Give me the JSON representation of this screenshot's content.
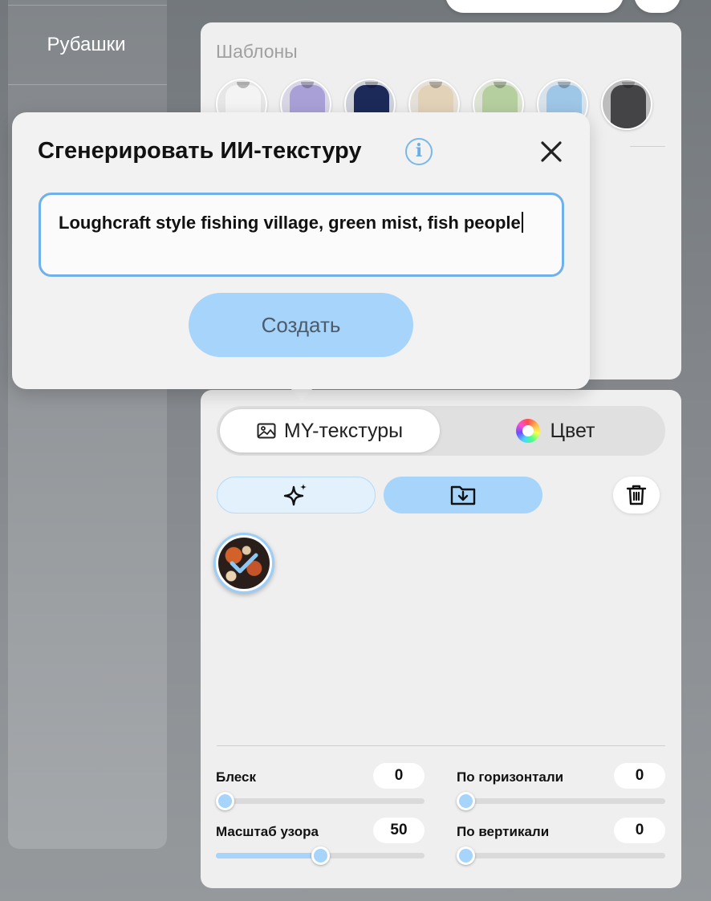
{
  "sidebar": {
    "active_item": "Рубашки"
  },
  "templates": {
    "title": "Шаблоны",
    "swatches": [
      {
        "name": "white",
        "color": "#f4f4f4"
      },
      {
        "name": "lavender",
        "color": "#a9a0d8"
      },
      {
        "name": "navy",
        "color": "#1c2a5a"
      },
      {
        "name": "beige",
        "color": "#e2d2b8"
      },
      {
        "name": "sage",
        "color": "#b6cf9f"
      },
      {
        "name": "sky",
        "color": "#9ec6e6"
      },
      {
        "name": "charcoal",
        "color": "#444446"
      }
    ]
  },
  "dialog": {
    "title": "Сгенерировать ИИ-текстуру",
    "info_icon": "info-icon",
    "close_icon": "close-icon",
    "prompt_value": "Loughcraft style fishing village, green mist, fish people",
    "create_label": "Создать"
  },
  "tabs": {
    "textures_label": "MY-текстуры",
    "color_label": "Цвет",
    "active": "textures"
  },
  "toolbar": {
    "ai_icon": "sparkles-icon",
    "upload_icon": "folder-download-icon",
    "delete_icon": "trash-icon"
  },
  "textures": [
    {
      "name": "mushroom-pattern",
      "selected": true
    }
  ],
  "controls": {
    "gloss": {
      "label": "Блеск",
      "value": "0",
      "percent": 0
    },
    "horizontal": {
      "label": "По горизонтали",
      "value": "0",
      "percent": 0
    },
    "scale": {
      "label": "Масштаб узора",
      "value": "50",
      "percent": 50
    },
    "vertical": {
      "label": "По вертикали",
      "value": "0",
      "percent": 0
    }
  },
  "colors": {
    "accent": "#a6d4fa",
    "focus_border": "#6fb1ea",
    "panel": "#efefef"
  }
}
